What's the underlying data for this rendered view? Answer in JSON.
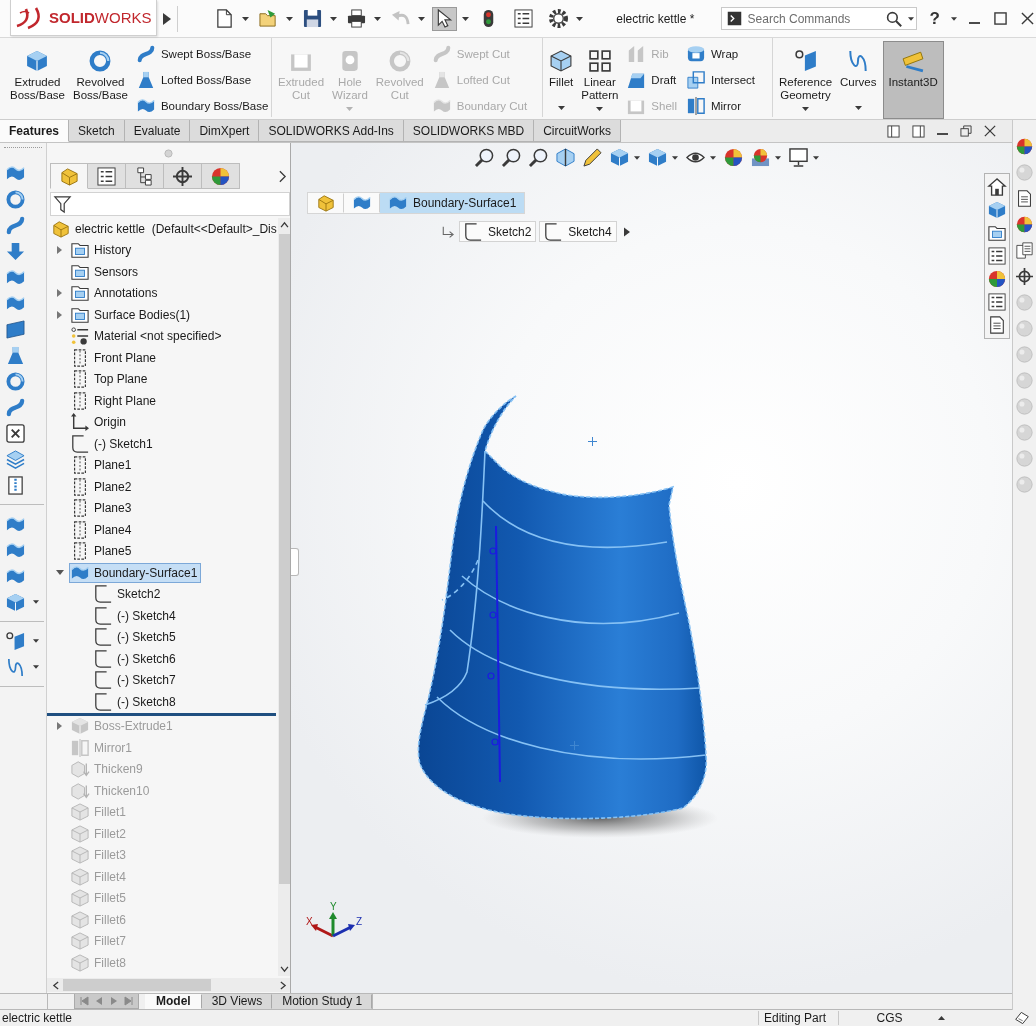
{
  "window": {
    "logo": "**SOLID**WORKS",
    "title": "electric kettle *",
    "help": "?"
  },
  "quick_access": [
    {
      "kind": "new",
      "dropdown": true,
      "disabled": false,
      "pressed": false
    },
    {
      "kind": "open",
      "dropdown": true,
      "disabled": false,
      "pressed": false
    },
    {
      "kind": "save",
      "dropdown": true,
      "disabled": false,
      "pressed": false
    },
    {
      "kind": "print",
      "dropdown": true,
      "disabled": false,
      "pressed": false
    },
    {
      "kind": "undo",
      "dropdown": true,
      "disabled": true,
      "pressed": false
    },
    {
      "kind": "select",
      "dropdown": true,
      "disabled": false,
      "pressed": true
    },
    {
      "kind": "rebuild",
      "dropdown": false,
      "disabled": false,
      "pressed": false
    },
    {
      "kind": "properties",
      "dropdown": false,
      "disabled": false,
      "pressed": false
    },
    {
      "kind": "options",
      "dropdown": true,
      "disabled": false,
      "pressed": false
    }
  ],
  "search": {
    "placeholder": "Search Commands"
  },
  "ribbon": {
    "groups": [
      {
        "items": [
          {
            "kind": "large",
            "label": "Extruded Boss/Base",
            "disabled": false,
            "pressed": false,
            "dropdown": false
          },
          {
            "kind": "large",
            "label": "Revolved Boss/Base",
            "disabled": false,
            "pressed": false,
            "dropdown": false
          },
          {
            "kind": "stack",
            "items": [
              {
                "label": "Swept Boss/Base",
                "disabled": false
              },
              {
                "label": "Lofted Boss/Base",
                "disabled": false
              },
              {
                "label": "Boundary Boss/Base",
                "disabled": false
              }
            ]
          }
        ]
      },
      {
        "items": [
          {
            "kind": "large",
            "label": "Extruded Cut",
            "disabled": true,
            "pressed": false,
            "dropdown": false
          },
          {
            "kind": "large",
            "label": "Hole Wizard",
            "disabled": true,
            "pressed": false,
            "dropdown": true
          },
          {
            "kind": "large",
            "label": "Revolved Cut",
            "disabled": true,
            "pressed": false,
            "dropdown": false
          },
          {
            "kind": "stack",
            "items": [
              {
                "label": "Swept Cut",
                "disabled": true
              },
              {
                "label": "Lofted Cut",
                "disabled": true
              },
              {
                "label": "Boundary Cut",
                "disabled": true
              }
            ]
          }
        ]
      },
      {
        "items": [
          {
            "kind": "large",
            "label": "Fillet",
            "disabled": false,
            "pressed": false,
            "dropdown": true
          },
          {
            "kind": "large",
            "label": "Linear Pattern",
            "disabled": false,
            "pressed": false,
            "dropdown": true
          },
          {
            "kind": "stack",
            "items": [
              {
                "label": "Rib",
                "disabled": true
              },
              {
                "label": "Draft",
                "disabled": false
              },
              {
                "label": "Shell",
                "disabled": true
              }
            ]
          },
          {
            "kind": "stack",
            "items": [
              {
                "label": "Wrap",
                "disabled": false
              },
              {
                "label": "Intersect",
                "disabled": false
              },
              {
                "label": "Mirror",
                "disabled": false
              }
            ]
          }
        ]
      },
      {
        "items": [
          {
            "kind": "large",
            "label": "Reference Geometry",
            "disabled": false,
            "pressed": false,
            "dropdown": true
          },
          {
            "kind": "large",
            "label": "Curves",
            "disabled": false,
            "pressed": false,
            "dropdown": true
          },
          {
            "kind": "large",
            "label": "Instant3D",
            "disabled": false,
            "pressed": true,
            "dropdown": false
          }
        ]
      }
    ]
  },
  "tabs": [
    {
      "label": "Features",
      "selected": true
    },
    {
      "label": "Sketch",
      "selected": false
    },
    {
      "label": "Evaluate",
      "selected": false
    },
    {
      "label": "DimXpert",
      "selected": false
    },
    {
      "label": "SOLIDWORKS Add-Ins",
      "selected": false
    },
    {
      "label": "SOLIDWORKS MBD",
      "selected": false
    },
    {
      "label": "CircuitWorks",
      "selected": false
    }
  ],
  "feature_tree": {
    "panel_tabs": [
      {
        "selected": true
      },
      {
        "selected": false
      },
      {
        "selected": false
      },
      {
        "selected": false
      },
      {
        "selected": false
      }
    ],
    "root": "electric kettle  (Default<<Default>_Dis",
    "items": [
      {
        "kind": "folder",
        "label": "History",
        "expanded": false,
        "selected": false
      },
      {
        "kind": "folder",
        "label": "Sensors",
        "selected": false
      },
      {
        "kind": "folder",
        "label": "Annotations",
        "expanded": false,
        "selected": false
      },
      {
        "kind": "folder",
        "label": "Surface Bodies(1)",
        "expanded": false,
        "selected": false
      },
      {
        "kind": "material",
        "label": "Material <not specified>",
        "selected": false
      },
      {
        "kind": "plane",
        "label": "Front Plane",
        "selected": false
      },
      {
        "kind": "plane",
        "label": "Top Plane",
        "selected": false
      },
      {
        "kind": "plane",
        "label": "Right Plane",
        "selected": false
      },
      {
        "kind": "origin",
        "label": "Origin",
        "selected": false
      },
      {
        "kind": "sketch",
        "label": "(-) Sketch1",
        "selected": false
      },
      {
        "kind": "plane",
        "label": "Plane1",
        "selected": false
      },
      {
        "kind": "plane",
        "label": "Plane2",
        "selected": false
      },
      {
        "kind": "plane",
        "label": "Plane3",
        "selected": false
      },
      {
        "kind": "plane",
        "label": "Plane4",
        "selected": false
      },
      {
        "kind": "plane",
        "label": "Plane5",
        "selected": false
      },
      {
        "kind": "boundary",
        "label": "Boundary-Surface1",
        "expanded": true,
        "selected": true,
        "children": [
          {
            "kind": "sketch",
            "label": "Sketch2",
            "selected": false
          },
          {
            "kind": "sketch",
            "label": "(-) Sketch4",
            "selected": false
          },
          {
            "kind": "sketch",
            "label": "(-) Sketch5",
            "selected": false
          },
          {
            "kind": "sketch",
            "label": "(-) Sketch6",
            "selected": false
          },
          {
            "kind": "sketch",
            "label": "(-) Sketch7",
            "selected": false
          },
          {
            "kind": "sketch",
            "label": "(-) Sketch8",
            "selected": false
          }
        ]
      }
    ],
    "rolled_back_items": [
      {
        "kind": "extrude",
        "label": "Boss-Extrude1",
        "expanded": false,
        "selected": false
      },
      {
        "kind": "mirror",
        "label": "Mirror1",
        "selected": false
      },
      {
        "kind": "thicken",
        "label": "Thicken9",
        "selected": false
      },
      {
        "kind": "thicken",
        "label": "Thicken10",
        "selected": false
      },
      {
        "kind": "fillet",
        "label": "Fillet1",
        "selected": false
      },
      {
        "kind": "fillet",
        "label": "Fillet2",
        "selected": false
      },
      {
        "kind": "fillet",
        "label": "Fillet3",
        "selected": false
      },
      {
        "kind": "fillet",
        "label": "Fillet4",
        "selected": false
      },
      {
        "kind": "fillet",
        "label": "Fillet5",
        "selected": false
      },
      {
        "kind": "fillet",
        "label": "Fillet6",
        "selected": false
      },
      {
        "kind": "fillet",
        "label": "Fillet7",
        "selected": false
      },
      {
        "kind": "fillet",
        "label": "Fillet8",
        "selected": false
      }
    ]
  },
  "viewport": {
    "breadcrumb": {
      "current": "Boundary-Surface1",
      "sketches": [
        "Sketch2",
        "Sketch4"
      ]
    },
    "triad": {
      "x": "X",
      "y": "Y",
      "z": "Z"
    }
  },
  "bottom_tabs": [
    {
      "label": "Model",
      "selected": true
    },
    {
      "label": "3D Views",
      "selected": false
    },
    {
      "label": "Motion Study 1",
      "selected": false
    }
  ],
  "status_bar": {
    "document": "electric kettle",
    "mode": "Editing Part",
    "units": "CGS"
  }
}
